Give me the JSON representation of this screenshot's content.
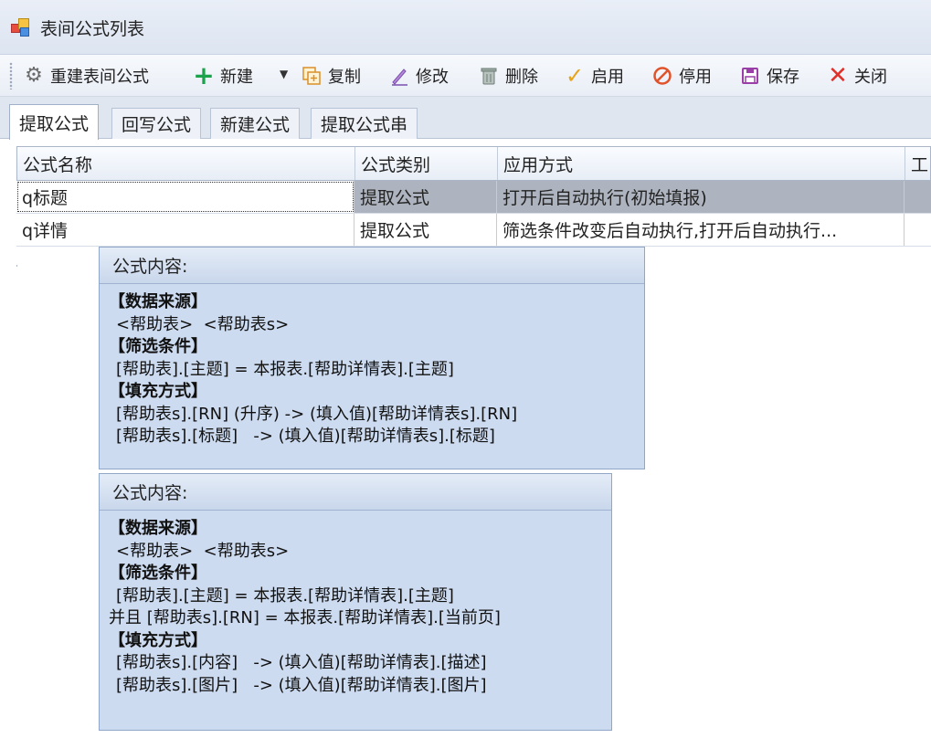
{
  "window": {
    "title": "表间公式列表",
    "icon": "app-grid-icon"
  },
  "toolbar": {
    "buttons": [
      {
        "label": "重建表间公式",
        "icon": "gear-icon"
      },
      {
        "label": "新建",
        "icon": "plus-icon"
      },
      {
        "label": "复制",
        "icon": "copy-icon"
      },
      {
        "label": "修改",
        "icon": "pencil-icon"
      },
      {
        "label": "删除",
        "icon": "trash-icon"
      },
      {
        "label": "启用",
        "icon": "check-icon"
      },
      {
        "label": "停用",
        "icon": "ban-icon"
      },
      {
        "label": "保存",
        "icon": "save-icon"
      },
      {
        "label": "关闭",
        "icon": "close-icon"
      }
    ]
  },
  "tabs": [
    "提取公式",
    "回写公式",
    "新建公式",
    "提取公式串"
  ],
  "grid": {
    "columns": [
      "公式名称",
      "公式类别",
      "应用方式",
      "工"
    ],
    "rows": [
      {
        "name": "q标题",
        "category": "提取公式",
        "mode": "打开后自动执行(初始填报)"
      },
      {
        "name": "q详情",
        "category": "提取公式",
        "mode": "筛选条件改变后自动执行,打开后自动执行..."
      }
    ]
  },
  "tooltips": [
    {
      "header": "公式内容:",
      "lines": [
        "【数据来源】",
        "<帮助表>  <帮助表s>",
        "【筛选条件】",
        "[帮助表].[主题] = 本报表.[帮助详情表].[主题]",
        "【填充方式】",
        "[帮助表s].[RN] (升序) -> (填入值)[帮助详情表s].[RN]",
        "[帮助表s].[标题]   -> (填入值)[帮助详情表s].[标题]"
      ]
    },
    {
      "header": "公式内容:",
      "lines": [
        "【数据来源】",
        "<帮助表>  <帮助表s>",
        "【筛选条件】",
        "[帮助表].[主题] = 本报表.[帮助详情表].[主题]",
        "并且 [帮助表s].[RN] = 本报表.[帮助详情表].[当前页]",
        "【填充方式】",
        "[帮助表s].[内容]   -> (填入值)[帮助详情表].[描述]",
        "[帮助表s].[图片]   -> (填入值)[帮助详情表].[图片]"
      ]
    }
  ],
  "colors": {
    "accent": "#4a90e2",
    "selected_row": "#aeb4bf",
    "tooltip_bg": "#cddbf0"
  }
}
